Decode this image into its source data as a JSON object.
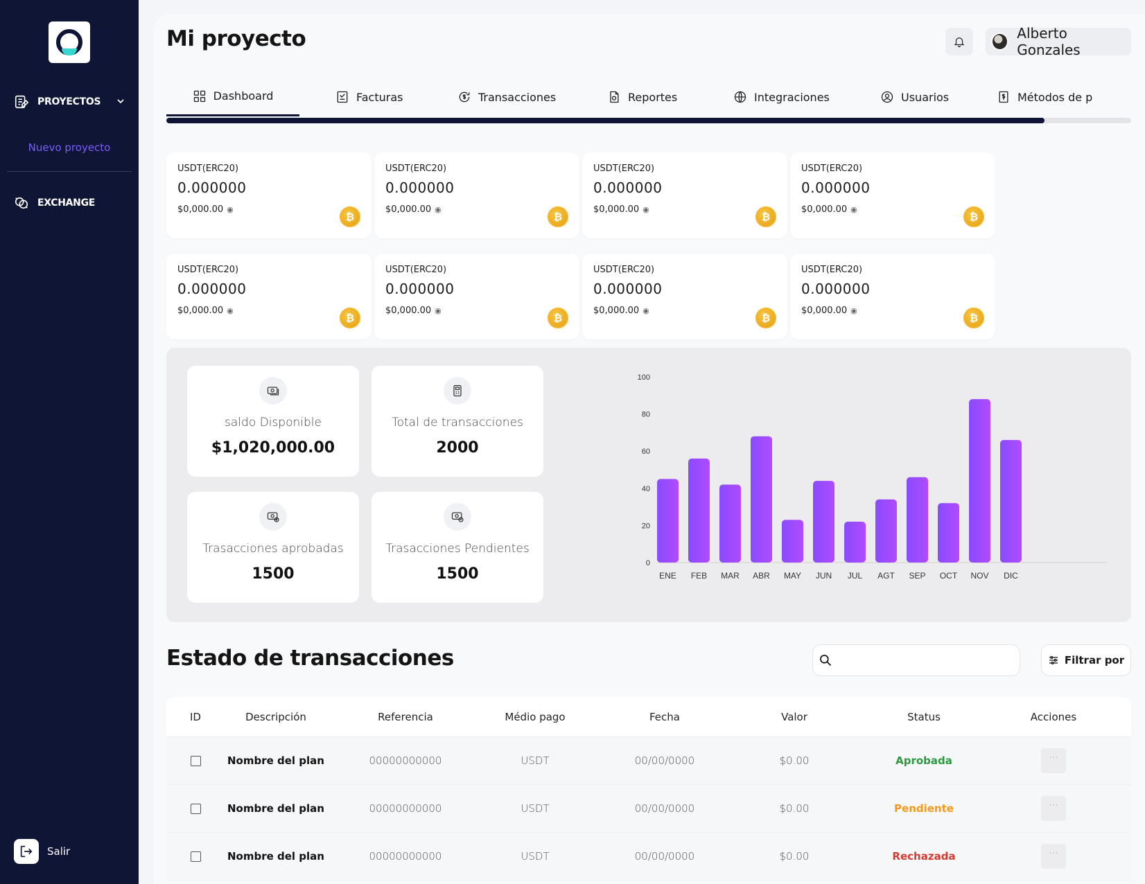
{
  "sidebar": {
    "proyectos_label": "PROYECTOS",
    "nuevo_proyecto": "Nuevo proyecto",
    "exchange_label": "EXCHANGE",
    "salir_label": "Salir"
  },
  "header": {
    "title": "Mi proyecto",
    "user_name": "Alberto Gonzales"
  },
  "tabs": [
    {
      "label": "Dashboard"
    },
    {
      "label": "Facturas"
    },
    {
      "label": "Transacciones"
    },
    {
      "label": "Reportes"
    },
    {
      "label": "Integraciones"
    },
    {
      "label": "Usuarios"
    },
    {
      "label": "Métodos de p"
    }
  ],
  "tabs_progress": 0.91,
  "wallets": [
    {
      "currency": "USDT(ERC20)",
      "amount": "0.000000",
      "fiat": "$0,000.00"
    },
    {
      "currency": "USDT(ERC20)",
      "amount": "0.000000",
      "fiat": "$0,000.00"
    },
    {
      "currency": "USDT(ERC20)",
      "amount": "0.000000",
      "fiat": "$0,000.00"
    },
    {
      "currency": "USDT(ERC20)",
      "amount": "0.000000",
      "fiat": "$0,000.00"
    },
    {
      "currency": "USDT(ERC20)",
      "amount": "0.000000",
      "fiat": "$0,000.00"
    },
    {
      "currency": "USDT(ERC20)",
      "amount": "0.000000",
      "fiat": "$0,000.00"
    },
    {
      "currency": "USDT(ERC20)",
      "amount": "0.000000",
      "fiat": "$0,000.00"
    },
    {
      "currency": "USDT(ERC20)",
      "amount": "0.000000",
      "fiat": "$0,000.00"
    }
  ],
  "stats": {
    "saldo": {
      "label": "saldo Disponible",
      "value": "$1,020,000.00"
    },
    "total": {
      "label": "Total de transacciones",
      "value": "2000"
    },
    "aprobadas": {
      "label": "Trasacciones aprobadas",
      "value": "1500"
    },
    "pendientes": {
      "label": "Trasacciones Pendientes",
      "value": "1500"
    }
  },
  "chart_data": {
    "type": "bar",
    "categories": [
      "ENE",
      "FEB",
      "MAR",
      "ABR",
      "MAY",
      "JUN",
      "JUL",
      "AGT",
      "SEP",
      "OCT",
      "NOV",
      "DIC"
    ],
    "values": [
      45,
      56,
      42,
      68,
      23,
      44,
      22,
      34,
      46,
      32,
      88,
      66
    ],
    "ylim": [
      0,
      100
    ],
    "yticks": [
      0,
      20,
      40,
      60,
      80,
      100
    ],
    "grid": false,
    "colors": {
      "bar_top": "#b04bff",
      "bar_bottom": "#8a4bff"
    }
  },
  "transactions": {
    "title": "Estado de transacciones",
    "search_placeholder": "",
    "filter_label": "Filtrar por",
    "columns": [
      "ID",
      "Descripción",
      "Referencia",
      "Médio pago",
      "Fecha",
      "Valor",
      "Status",
      "Acciones"
    ],
    "rows": [
      {
        "descripcion": "Nombre del plan",
        "referencia": "00000000000",
        "medio": "USDT",
        "fecha": "00/00/0000",
        "valor": "$0.00",
        "status": "Aprobada",
        "status_key": "aprobada",
        "acciones": "···"
      },
      {
        "descripcion": "Nombre del plan",
        "referencia": "00000000000",
        "medio": "USDT",
        "fecha": "00/00/0000",
        "valor": "$0.00",
        "status": "Pendiente",
        "status_key": "pendiente",
        "acciones": "···"
      },
      {
        "descripcion": "Nombre del plan",
        "referencia": "00000000000",
        "medio": "USDT",
        "fecha": "00/00/0000",
        "valor": "$0.00",
        "status": "Rechazada",
        "status_key": "rechazada",
        "acciones": "···"
      }
    ]
  },
  "colors": {
    "sidebar_bg": "#0f1535",
    "accent_purple": "#7b5cff",
    "status_aprobada": "#2b9a3e",
    "status_pendiente": "#f39a1c",
    "status_rechazada": "#d53a2f"
  }
}
